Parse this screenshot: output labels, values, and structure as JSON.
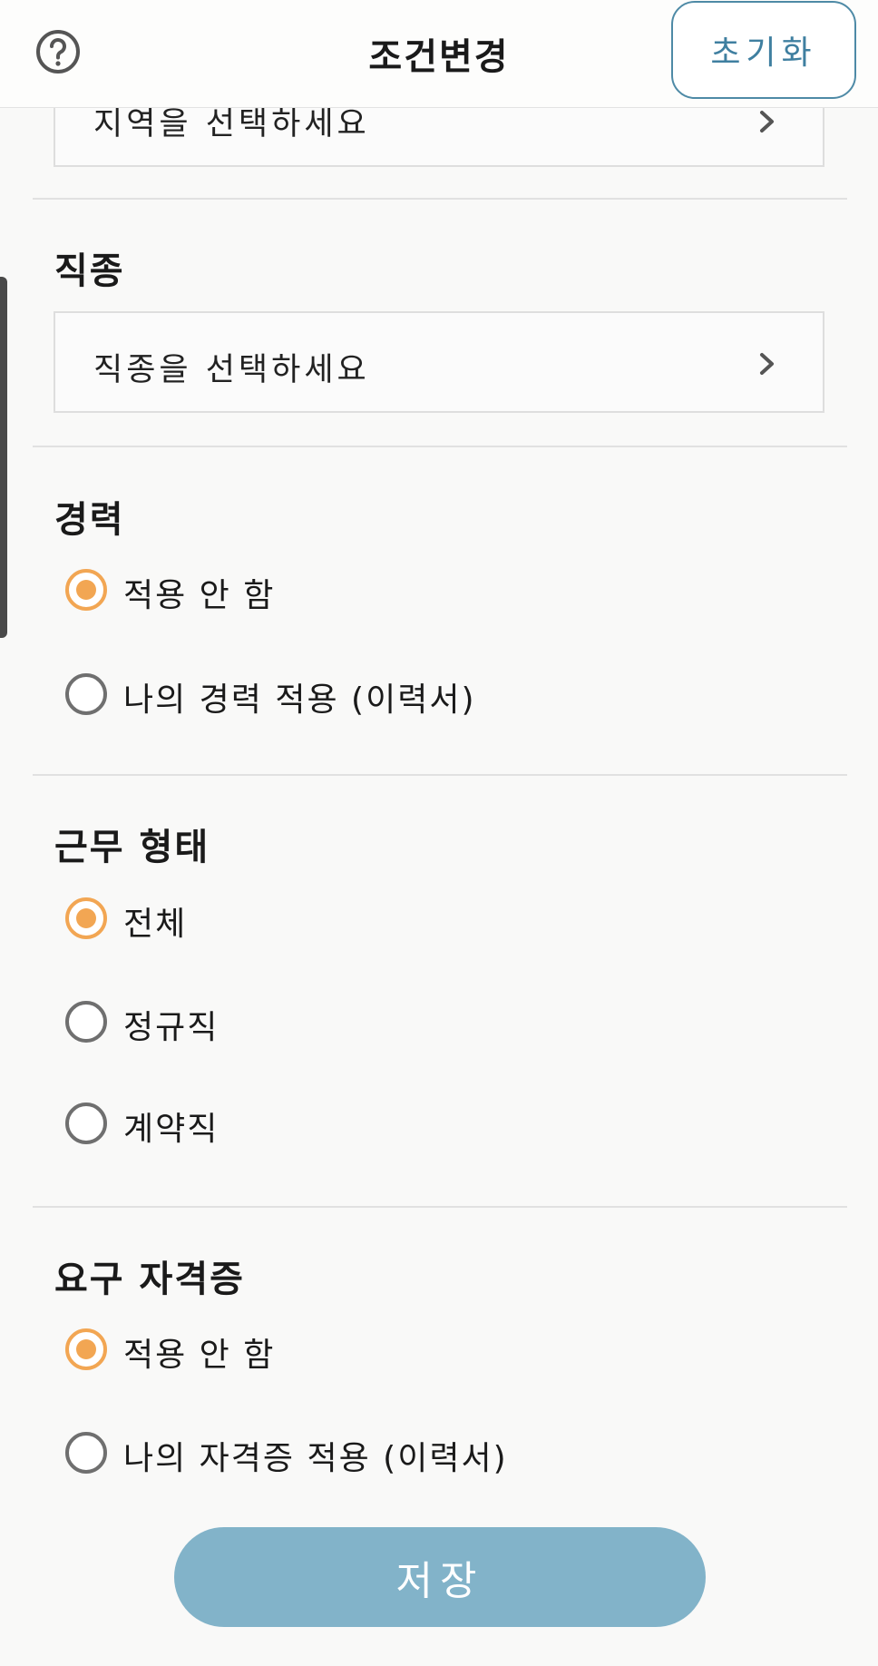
{
  "header": {
    "title": "조건변경",
    "help_icon": "question-circle-icon",
    "reset_label": "초기화",
    "accent_color": "#4e8aa6"
  },
  "region": {
    "placeholder": "지역을 선택하세요"
  },
  "job_type": {
    "title": "직종",
    "placeholder": "직종을 선택하세요"
  },
  "career": {
    "title": "경력",
    "options": [
      {
        "label": "적용 안 함",
        "selected": true
      },
      {
        "label": "나의 경력 적용 (이력서)",
        "selected": false
      }
    ]
  },
  "employment": {
    "title": "근무 형태",
    "options": [
      {
        "label": "전체",
        "selected": true
      },
      {
        "label": "정규직",
        "selected": false
      },
      {
        "label": "계약직",
        "selected": false
      }
    ]
  },
  "certificate": {
    "title": "요구 자격증",
    "options": [
      {
        "label": "적용 안 함",
        "selected": true
      },
      {
        "label": "나의 자격증 적용 (이력서)",
        "selected": false
      }
    ]
  },
  "save_label": "저장",
  "colors": {
    "radio_selected": "#f2a653",
    "save_button": "#82b3c9"
  }
}
